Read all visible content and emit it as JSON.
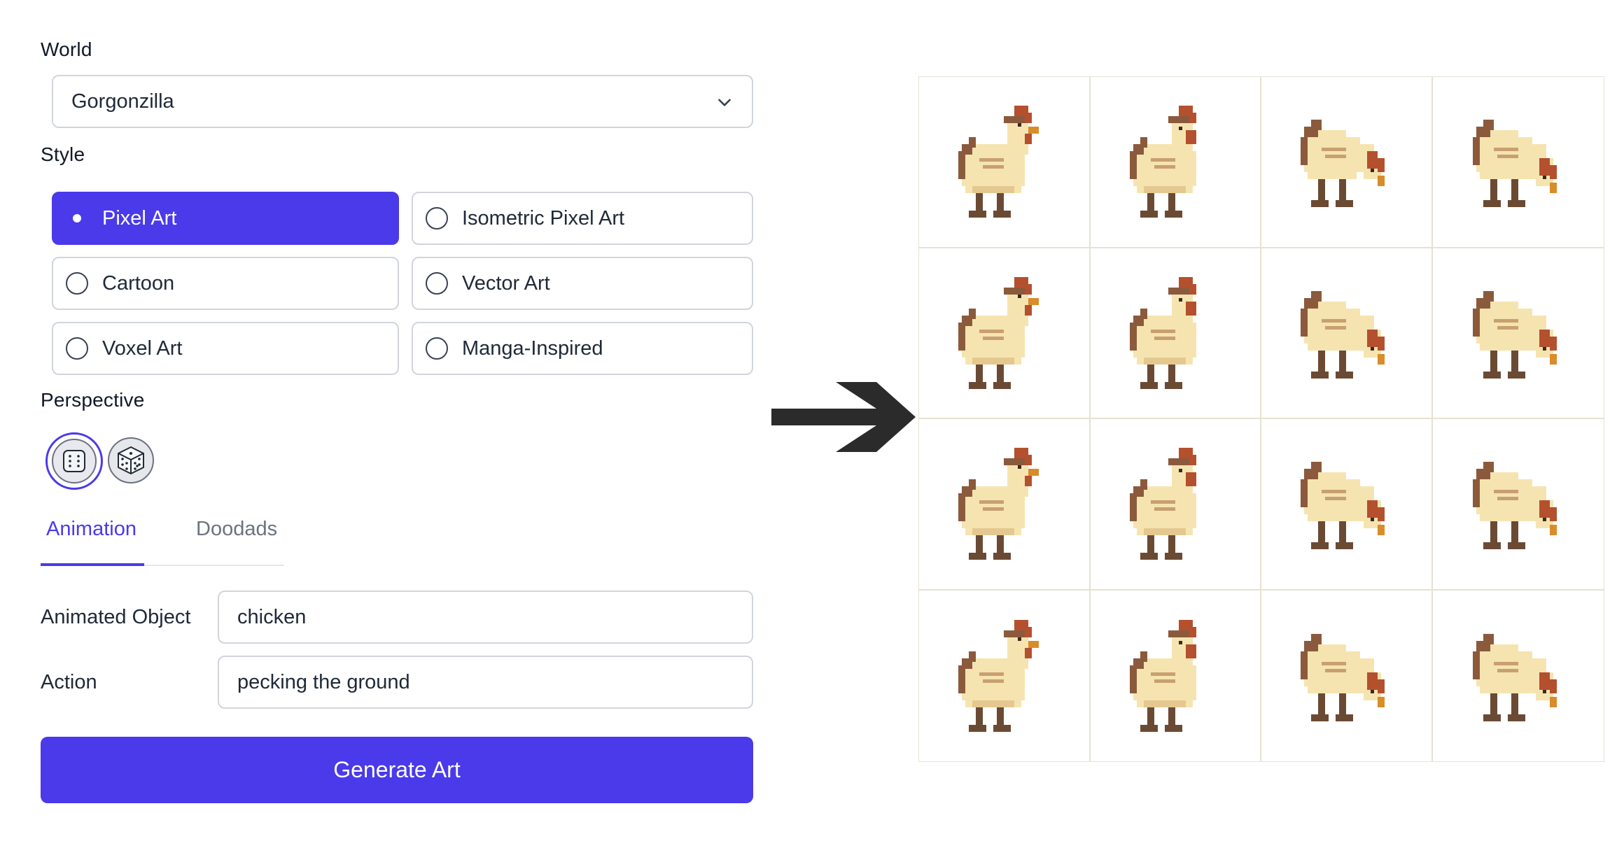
{
  "world": {
    "label": "World",
    "selected": "Gorgonzilla"
  },
  "style": {
    "label": "Style",
    "options": [
      {
        "label": "Pixel Art",
        "selected": true
      },
      {
        "label": "Isometric Pixel Art",
        "selected": false
      },
      {
        "label": "Cartoon",
        "selected": false
      },
      {
        "label": "Vector Art",
        "selected": false
      },
      {
        "label": "Voxel Art",
        "selected": false
      },
      {
        "label": "Manga-Inspired",
        "selected": false
      }
    ]
  },
  "perspective": {
    "label": "Perspective",
    "options": [
      {
        "icon": "dice-flat-icon",
        "selected": true
      },
      {
        "icon": "dice-isometric-icon",
        "selected": false
      }
    ]
  },
  "tabs": [
    {
      "label": "Animation",
      "active": true
    },
    {
      "label": "Doodads",
      "active": false
    }
  ],
  "fields": {
    "animated_object": {
      "label": "Animated Object",
      "value": "chicken"
    },
    "action": {
      "label": "Action",
      "value": "pecking the ground"
    }
  },
  "generate_button": {
    "label": "Generate Art"
  },
  "colors": {
    "accent": "#4a3aea",
    "chicken_body": "#f6e4b0",
    "chicken_shade": "#8b5a3c",
    "comb": "#b4502e",
    "beak": "#d98c2a"
  },
  "sprite_sheet": {
    "rows": 4,
    "columns": 4,
    "frames": [
      {
        "pose": "standing"
      },
      {
        "pose": "turning"
      },
      {
        "pose": "lowering"
      },
      {
        "pose": "pecking"
      },
      {
        "pose": "standing"
      },
      {
        "pose": "turning"
      },
      {
        "pose": "pecking"
      },
      {
        "pose": "pecking"
      },
      {
        "pose": "standing"
      },
      {
        "pose": "turning"
      },
      {
        "pose": "pecking"
      },
      {
        "pose": "pecking"
      },
      {
        "pose": "standing"
      },
      {
        "pose": "turning"
      },
      {
        "pose": "pecking"
      },
      {
        "pose": "pecking"
      }
    ]
  }
}
